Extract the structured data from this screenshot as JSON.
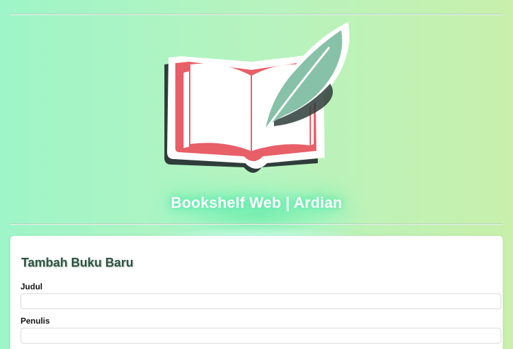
{
  "header": {
    "site_title": "Bookshelf Web | Ardian",
    "logo_icon": "book-quill-logo-icon"
  },
  "colors": {
    "book_red": "#e85f68",
    "book_shadow": "#2f3d3b",
    "quill_green": "#86c1a8",
    "title_glow": "#3fe6a0"
  },
  "form": {
    "title": "Tambah Buku Baru",
    "fields": [
      {
        "label": "Judul",
        "value": "",
        "placeholder": ""
      },
      {
        "label": "Penulis",
        "value": "",
        "placeholder": ""
      }
    ]
  }
}
